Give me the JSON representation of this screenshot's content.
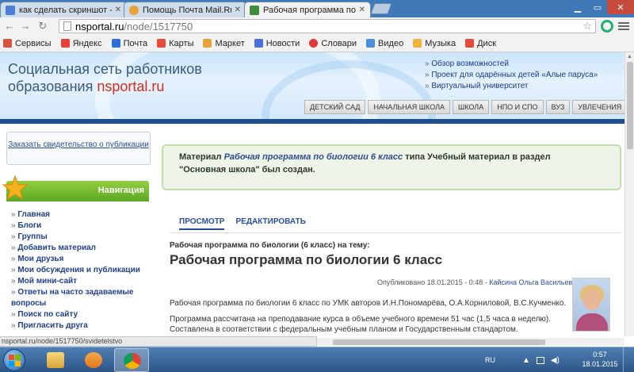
{
  "browser": {
    "tabs": [
      {
        "title": "как сделать скриншот - ",
        "favicon_color": "#4a7fd9"
      },
      {
        "title": "Помощь Почта Mail.Ru",
        "favicon_color": "#e8a23a"
      },
      {
        "title": "Рабочая программа по б",
        "favicon_color": "#3d8d3d",
        "active": true
      }
    ],
    "url_host": "nsportal.ru",
    "url_path": "/node/1517750",
    "bookmarks": [
      {
        "label": "Сервисы",
        "icon_color": "#d9533f"
      },
      {
        "label": "Яндекс",
        "icon_color": "#e6413a"
      },
      {
        "label": "Почта",
        "icon_color": "#2e6ed8"
      },
      {
        "label": "Карты",
        "icon_color": "#e84a3a"
      },
      {
        "label": "Маркет",
        "icon_color": "#e8a23a"
      },
      {
        "label": "Новости",
        "icon_color": "#4a6fd9"
      },
      {
        "label": "Словари",
        "icon_color": "#e03a3a"
      },
      {
        "label": "Видео",
        "icon_color": "#4a90d9"
      },
      {
        "label": "Музыка",
        "icon_color": "#f0b33a"
      },
      {
        "label": "Диск",
        "icon_color": "#e84a3a"
      }
    ]
  },
  "site": {
    "logo_line1": "Социальная сеть работников",
    "logo_line2_prefix": "образования ",
    "logo_brand_ns": "ns",
    "logo_brand_rest": "portal.ru",
    "header_links": [
      "Обзор возможностей",
      "Проект для одарённых детей «Алые паруса»",
      "Виртуальный университет"
    ],
    "header_nav": [
      "ДЕТСКИЙ САД",
      "НАЧАЛЬНАЯ ШКОЛА",
      "ШКОЛА",
      "НПО И СПО",
      "ВУЗ",
      "УВЛЕЧЕНИЯ"
    ]
  },
  "sidebar": {
    "cert_link": "Заказать свидетельство о публикации",
    "nav_title": "Навигация",
    "nav_items": [
      "Главная",
      "Блоги",
      "Группы",
      "Добавить материал",
      "Мои друзья",
      "Мои обсуждения и публикации",
      "Мой мини-сайт",
      "Ответы на часто задаваемые вопросы",
      "Поиск по сайту",
      "Пригласить друга"
    ]
  },
  "main": {
    "notice_prefix": "Материал ",
    "notice_title": "Рабочая программа по биологии 6 класс",
    "notice_mid": " типа Учебный материал в раздел",
    "notice_end": "\"Основная школа\" был создан.",
    "tab_view": "ПРОСМОТР",
    "tab_edit": "РЕДАКТИРОВАТЬ",
    "subtitle": "Рабочая программа по биологии (6 класс) на тему:",
    "title": "Рабочая программа по биологии 6 класс",
    "published_prefix": "Опубликовано 18.01.2015 - 0:48 - ",
    "author": "Кайсина Ольга Васильевна",
    "paragraphs": [
      "Рабочая программа по биологии 6 класс по УМК авторов  И.Н.Пономарёва, О.А.Корниловой, В.С.Кучменко.",
      "Программа рассчитана на преподавание курса в объеме учебного времени 51 час (1,5 часа в неделю).",
      "Составлена в соответствии с федеральным учебным планом и Государственным стандартом."
    ]
  },
  "status_url": "nsportal.ru/node/1517750/svidetelstvo",
  "taskbar": {
    "lang": "RU",
    "time": "0:57",
    "date": "18.01.2015"
  }
}
